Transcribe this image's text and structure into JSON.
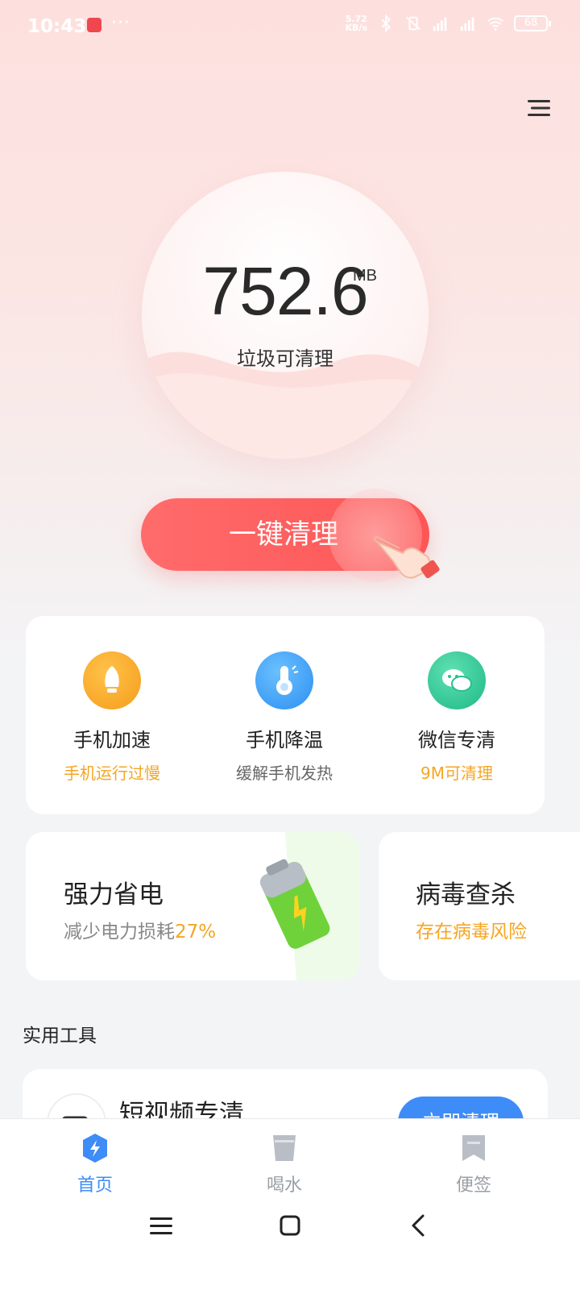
{
  "status_bar": {
    "time": "10:43",
    "dots": "···",
    "net_speed_value": "5.72",
    "net_speed_unit": "KB/s",
    "battery": "68"
  },
  "hero": {
    "value": "752.6",
    "unit": "MB",
    "label": "垃圾可清理"
  },
  "clean_button": {
    "label": "一键清理"
  },
  "tools": [
    {
      "title": "手机加速",
      "subtitle": "手机运行过慢",
      "icon": "rocket-icon",
      "color": "#f5a623",
      "sub_color": "#f5a623"
    },
    {
      "title": "手机降温",
      "subtitle": "缓解手机发热",
      "icon": "thermometer-icon",
      "color": "#3aa0f5",
      "sub_color": "#666666"
    },
    {
      "title": "微信专清",
      "subtitle": "9M可清理",
      "icon": "wechat-icon",
      "color": "#2ec795",
      "sub_color": "#f5a623"
    }
  ],
  "features": {
    "power": {
      "title": "强力省电",
      "subtitle_prefix": "减少电力损耗",
      "subtitle_accent": "27%"
    },
    "virus": {
      "title": "病毒查杀",
      "subtitle": "存在病毒风险"
    }
  },
  "section": {
    "title": "实用工具"
  },
  "list": [
    {
      "title": "短视频专清",
      "button": "立即清理"
    }
  ],
  "bottom_nav": [
    {
      "label": "首页",
      "icon": "bolt-icon",
      "active": true
    },
    {
      "label": "喝水",
      "icon": "cup-icon",
      "active": false
    },
    {
      "label": "便签",
      "icon": "bookmark-icon",
      "active": false
    }
  ],
  "colors": {
    "accent_red": "#fe5656",
    "accent_orange": "#f5a623",
    "accent_blue": "#3d8cf7"
  }
}
